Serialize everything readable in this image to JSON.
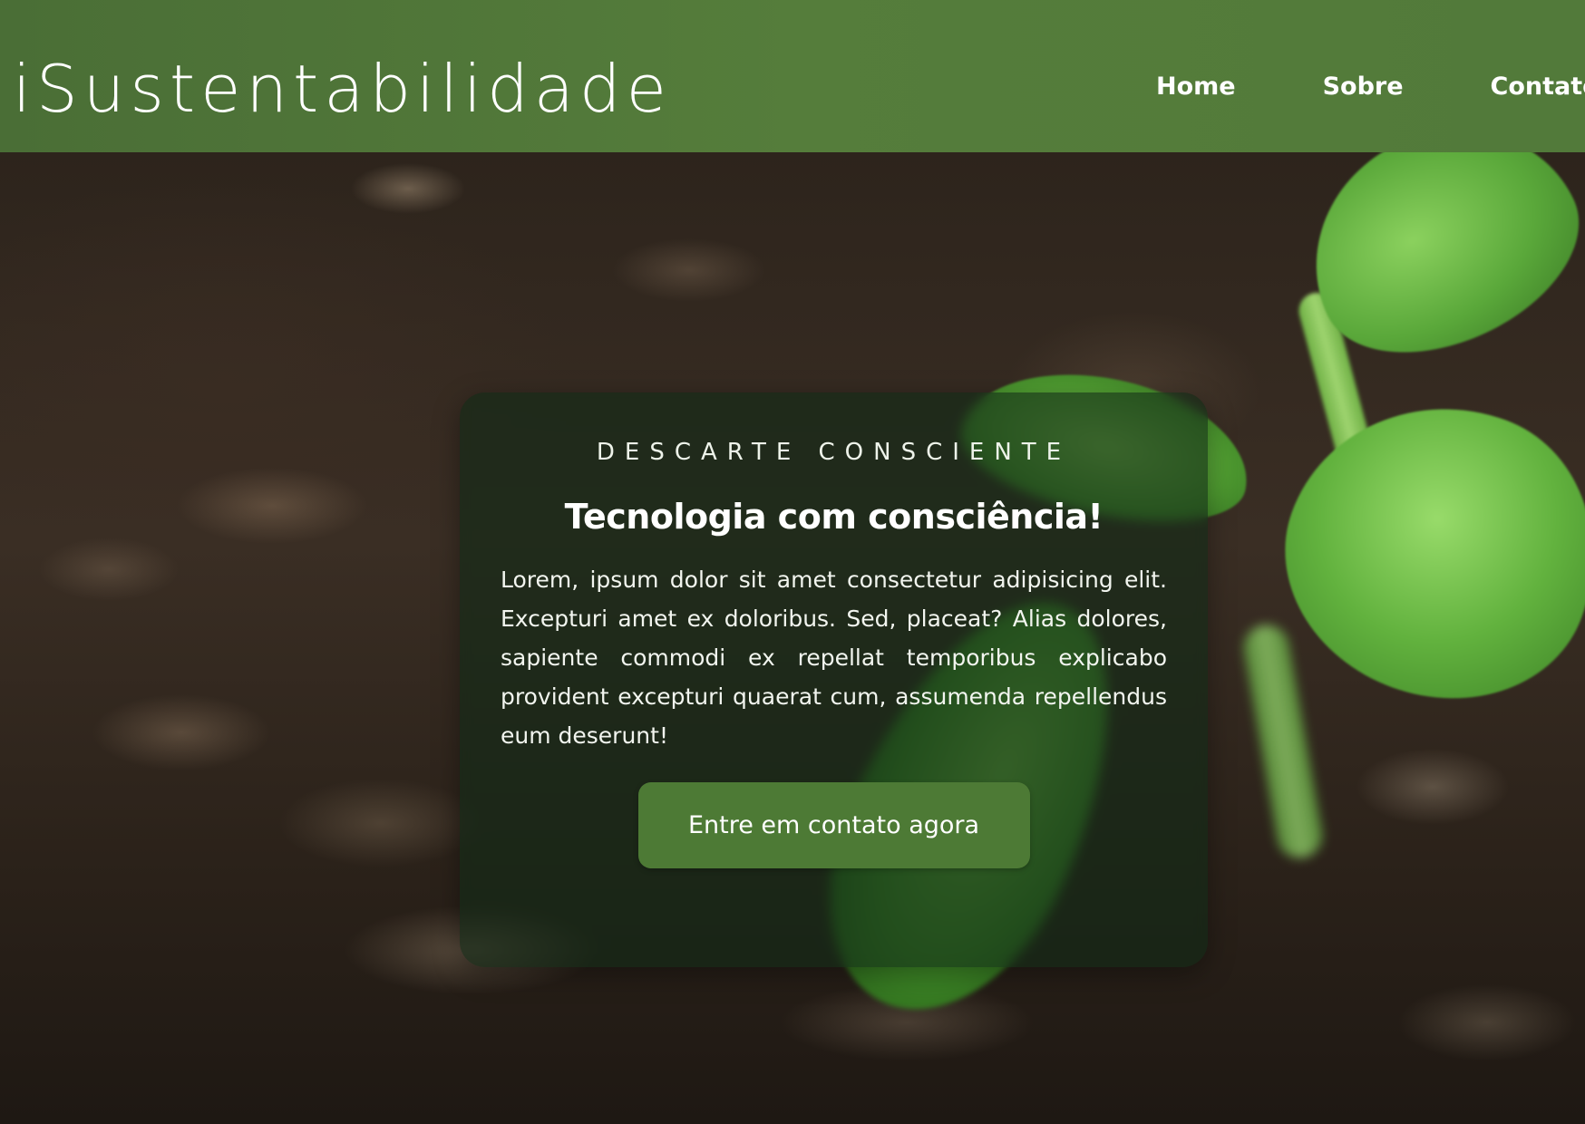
{
  "header": {
    "brand": "iSustentabilidade",
    "nav": [
      {
        "label": "Home"
      },
      {
        "label": "Sobre"
      },
      {
        "label": "Contato"
      }
    ]
  },
  "hero": {
    "eyebrow": "DESCARTE CONSCIENTE",
    "headline": "Tecnologia com consciência!",
    "body": "Lorem, ipsum dolor sit amet consectetur adipisicing elit. Excepturi amet ex doloribus. Sed, placeat? Alias dolores, sapiente commodi ex repellat temporibus explicabo provident excepturi quaerat cum, assumenda repellendus eum deserunt!",
    "cta_label": "Entre em contato agora"
  },
  "colors": {
    "header_green": "#557d3b",
    "button_green": "#4d7a35",
    "card_overlay": "#122a16",
    "text": "#ffffff"
  }
}
